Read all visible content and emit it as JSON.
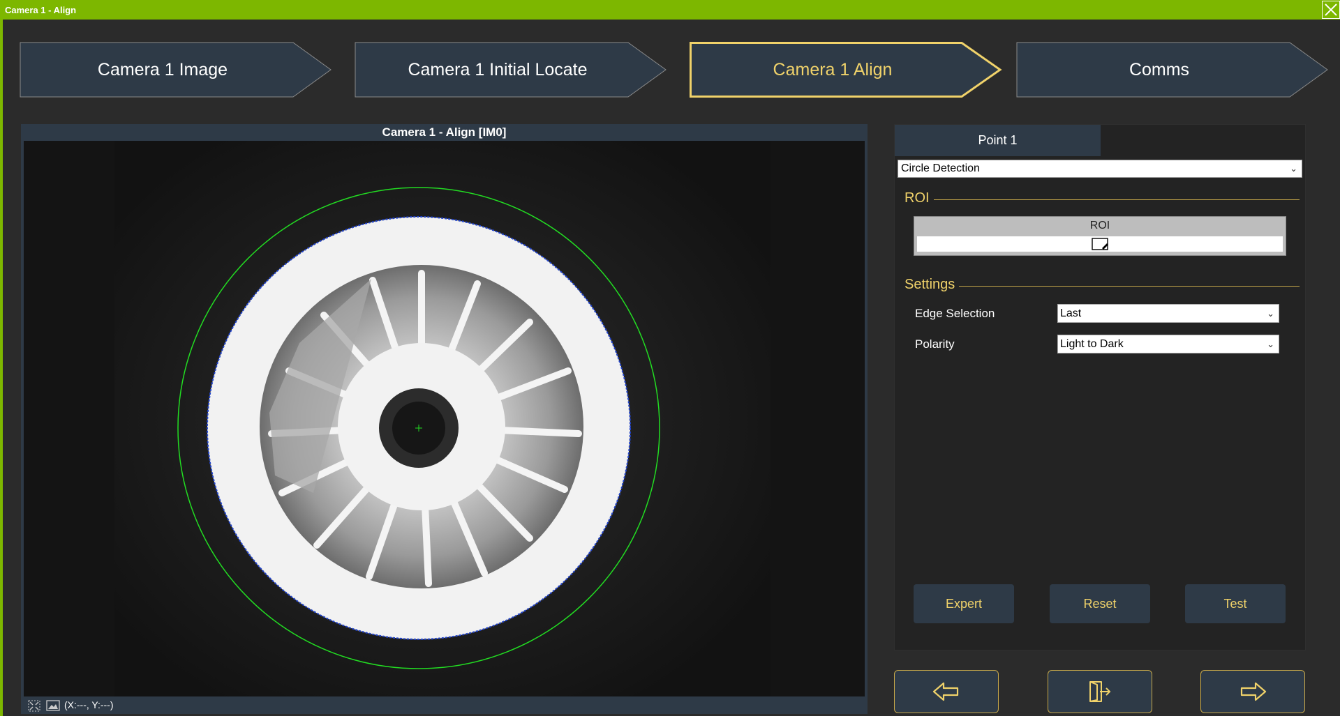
{
  "window": {
    "title": "Camera 1 - Align"
  },
  "steps": [
    {
      "label": "Camera 1 Image",
      "active": false
    },
    {
      "label": "Camera 1 Initial Locate",
      "active": false
    },
    {
      "label": "Camera 1 Align",
      "active": true
    },
    {
      "label": "Comms",
      "active": false
    }
  ],
  "viewer": {
    "title": "Camera 1 - Align  [IM0]",
    "coords": "(X:---, Y:---)"
  },
  "panel": {
    "tab": "Point 1",
    "method": "Circle Detection",
    "roi_group": "ROI",
    "roi_header": "ROI",
    "settings_group": "Settings",
    "edge_selection_label": "Edge Selection",
    "edge_selection_value": "Last",
    "polarity_label": "Polarity",
    "polarity_value": "Light to Dark",
    "expert": "Expert",
    "reset": "Reset",
    "test": "Test"
  },
  "colors": {
    "accent": "#7db700",
    "highlight": "#f0d26a",
    "panel": "#2e3a47"
  },
  "icons": {
    "back": "arrow-left-icon",
    "exit": "exit-door-icon",
    "next": "arrow-right-icon"
  }
}
